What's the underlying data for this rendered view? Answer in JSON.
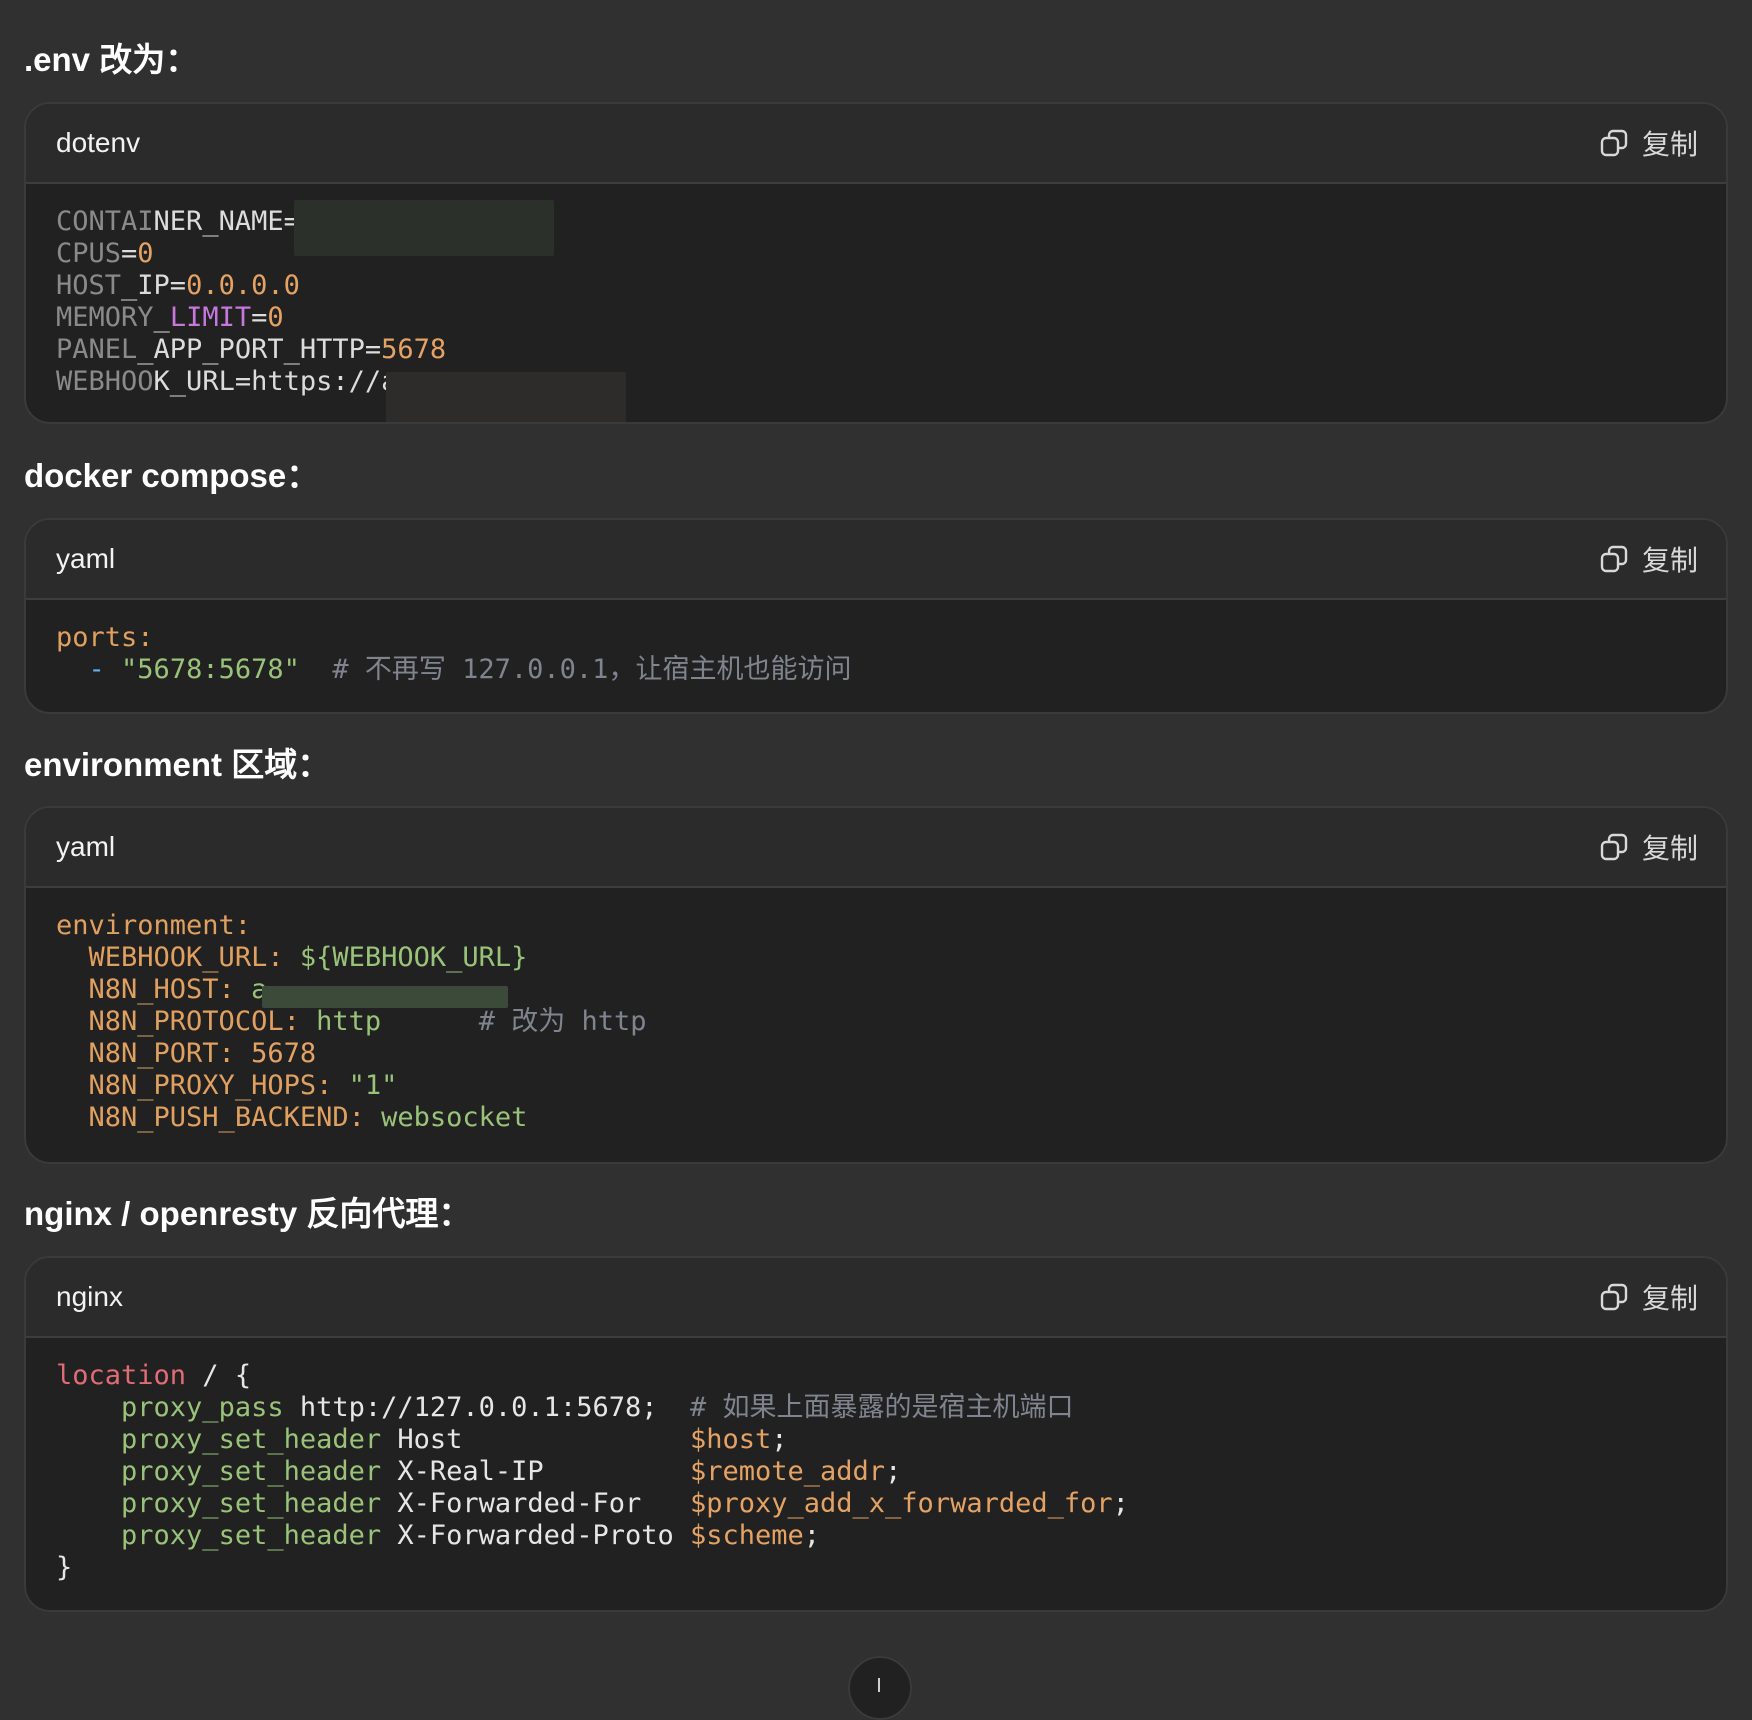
{
  "sections": [
    {
      "heading": ".env 改为：",
      "lang": "dotenv",
      "copy_label": "复制",
      "lines": [
        [
          [
            "c-key-dim",
            "CONTAI"
          ],
          [
            "c-key",
            "NER_NAME="
          ]
        ],
        [
          [
            "c-key-dim",
            "CPUS"
          ],
          [
            "c-key",
            "="
          ],
          [
            "c-num",
            "0"
          ]
        ],
        [
          [
            "c-key-dim",
            "HOST"
          ],
          [
            "c-key",
            "_IP="
          ],
          [
            "c-num",
            "0.0.0.0"
          ]
        ],
        [
          [
            "c-key-dim",
            "MEMORY"
          ],
          [
            "c-key",
            "_"
          ],
          [
            "c-purple",
            "LIMIT"
          ],
          [
            "c-key",
            "="
          ],
          [
            "c-num",
            "0"
          ]
        ],
        [
          [
            "c-key-dim",
            "PANEL"
          ],
          [
            "c-key",
            "_APP_PORT_HTTP="
          ],
          [
            "c-num",
            "5678"
          ]
        ],
        [
          [
            "c-key-dim",
            "WEBHOO"
          ],
          [
            "c-key",
            "K_URL=https://a"
          ]
        ]
      ]
    },
    {
      "heading": "docker compose：",
      "lang": "yaml",
      "copy_label": "复制",
      "lines": [
        [
          [
            "c-yamlkey",
            "ports:"
          ]
        ],
        [
          [
            "c-plain",
            "  "
          ],
          [
            "c-blue",
            "-"
          ],
          [
            "c-plain",
            " "
          ],
          [
            "c-green",
            "\"5678:5678\""
          ],
          [
            "c-plain",
            "  "
          ],
          [
            "c-comment",
            "# 不再写 127.0.0.1，让宿主机也能访问"
          ]
        ]
      ]
    },
    {
      "heading": "environment 区域：",
      "lang": "yaml",
      "copy_label": "复制",
      "lines": [
        [
          [
            "c-yamlkey",
            "environment:"
          ]
        ],
        [
          [
            "c-plain",
            "  "
          ],
          [
            "c-yamlkey",
            "WEBHOOK_URL:"
          ],
          [
            "c-plain",
            " "
          ],
          [
            "c-green",
            "${WEBHOOK_URL}"
          ]
        ],
        [
          [
            "c-plain",
            "  "
          ],
          [
            "c-yamlkey",
            "N8N_HOST:"
          ],
          [
            "c-plain",
            " "
          ],
          [
            "c-green",
            "a"
          ]
        ],
        [
          [
            "c-plain",
            "  "
          ],
          [
            "c-yamlkey",
            "N8N_PROTOCOL:"
          ],
          [
            "c-plain",
            " "
          ],
          [
            "c-green",
            "http"
          ],
          [
            "c-plain",
            "      "
          ],
          [
            "c-comment",
            "# 改为 http"
          ]
        ],
        [
          [
            "c-plain",
            "  "
          ],
          [
            "c-yamlkey",
            "N8N_PORT:"
          ],
          [
            "c-plain",
            " "
          ],
          [
            "c-num",
            "5678"
          ]
        ],
        [
          [
            "c-plain",
            "  "
          ],
          [
            "c-yamlkey",
            "N8N_PROXY_HOPS:"
          ],
          [
            "c-plain",
            " "
          ],
          [
            "c-green",
            "\"1\""
          ]
        ],
        [
          [
            "c-plain",
            "  "
          ],
          [
            "c-yamlkey",
            "N8N_PUSH_BACKEND:"
          ],
          [
            "c-plain",
            " "
          ],
          [
            "c-green",
            "websocket"
          ]
        ]
      ]
    },
    {
      "heading": "nginx / openresty 反向代理：",
      "lang": "nginx",
      "copy_label": "复制",
      "lines": [
        [
          [
            "c-red",
            "location"
          ],
          [
            "c-plain",
            " / {"
          ]
        ],
        [
          [
            "c-plain",
            "    "
          ],
          [
            "c-green",
            "proxy_pass"
          ],
          [
            "c-plain",
            " http://127.0.0.1:5678;  "
          ],
          [
            "c-comment",
            "# 如果上面暴露的是宿主机端口"
          ]
        ],
        [
          [
            "c-plain",
            "    "
          ],
          [
            "c-green",
            "proxy_set_header"
          ],
          [
            "c-plain",
            " Host              "
          ],
          [
            "c-num",
            "$host"
          ],
          [
            "c-plain",
            ";"
          ]
        ],
        [
          [
            "c-plain",
            "    "
          ],
          [
            "c-green",
            "proxy_set_header"
          ],
          [
            "c-plain",
            " X-Real-IP         "
          ],
          [
            "c-num",
            "$remote_addr"
          ],
          [
            "c-plain",
            ";"
          ]
        ],
        [
          [
            "c-plain",
            "    "
          ],
          [
            "c-green",
            "proxy_set_header"
          ],
          [
            "c-plain",
            " X-Forwarded-For   "
          ],
          [
            "c-num",
            "$proxy_add_x_forwarded_for"
          ],
          [
            "c-plain",
            ";"
          ]
        ],
        [
          [
            "c-plain",
            "    "
          ],
          [
            "c-green",
            "proxy_set_header"
          ],
          [
            "c-plain",
            " X-Forwarded-Proto "
          ],
          [
            "c-num",
            "$scheme"
          ],
          [
            "c-plain",
            ";"
          ]
        ],
        [
          [
            "c-plain",
            "}"
          ]
        ]
      ]
    }
  ],
  "icons": {
    "copy": "copy-icon",
    "scroll": "arrow-down-icon"
  }
}
